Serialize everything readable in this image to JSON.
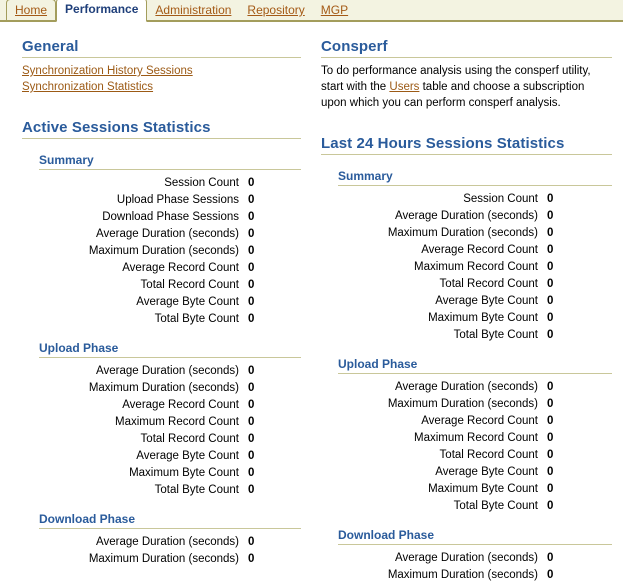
{
  "tabs": [
    {
      "label": "Home",
      "active": false,
      "style": "first"
    },
    {
      "label": "Performance",
      "active": true,
      "style": "active"
    },
    {
      "label": "Administration",
      "active": false,
      "style": "plain"
    },
    {
      "label": "Repository",
      "active": false,
      "style": "plain"
    },
    {
      "label": "MGP",
      "active": false,
      "style": "plain"
    }
  ],
  "general": {
    "heading": "General",
    "links": [
      "Synchronization History Sessions",
      "Synchronization Statistics"
    ]
  },
  "consperf": {
    "heading": "Consperf",
    "text_before": "To do performance analysis using the consperf utility, start with the ",
    "link": "Users",
    "text_after": " table and choose a subscription upon which you can perform consperf analysis."
  },
  "active_sessions": {
    "heading": "Active Sessions Statistics",
    "groups": [
      {
        "title": "Summary",
        "rows": [
          {
            "label": "Session Count",
            "value": "0"
          },
          {
            "label": "Upload Phase Sessions",
            "value": "0"
          },
          {
            "label": "Download Phase Sessions",
            "value": "0"
          },
          {
            "label": "Average Duration (seconds)",
            "value": "0"
          },
          {
            "label": "Maximum Duration (seconds)",
            "value": "0"
          },
          {
            "label": "Average Record Count",
            "value": "0"
          },
          {
            "label": "Total Record Count",
            "value": "0"
          },
          {
            "label": "Average Byte Count",
            "value": "0"
          },
          {
            "label": "Total Byte Count",
            "value": "0"
          }
        ]
      },
      {
        "title": "Upload Phase",
        "rows": [
          {
            "label": "Average Duration (seconds)",
            "value": "0"
          },
          {
            "label": "Maximum Duration (seconds)",
            "value": "0"
          },
          {
            "label": "Average Record Count",
            "value": "0"
          },
          {
            "label": "Maximum Record Count",
            "value": "0"
          },
          {
            "label": "Total Record Count",
            "value": "0"
          },
          {
            "label": "Average Byte Count",
            "value": "0"
          },
          {
            "label": "Maximum Byte Count",
            "value": "0"
          },
          {
            "label": "Total Byte Count",
            "value": "0"
          }
        ]
      },
      {
        "title": "Download Phase",
        "rows": [
          {
            "label": "Average Duration (seconds)",
            "value": "0"
          },
          {
            "label": "Maximum Duration (seconds)",
            "value": "0"
          }
        ]
      }
    ]
  },
  "last_24_hours": {
    "heading": "Last 24 Hours Sessions Statistics",
    "groups": [
      {
        "title": "Summary",
        "rows": [
          {
            "label": "Session Count",
            "value": "0"
          },
          {
            "label": "Average Duration (seconds)",
            "value": "0"
          },
          {
            "label": "Maximum Duration (seconds)",
            "value": "0"
          },
          {
            "label": "Average Record Count",
            "value": "0"
          },
          {
            "label": "Maximum Record Count",
            "value": "0"
          },
          {
            "label": "Total Record Count",
            "value": "0"
          },
          {
            "label": "Average Byte Count",
            "value": "0"
          },
          {
            "label": "Maximum Byte Count",
            "value": "0"
          },
          {
            "label": "Total Byte Count",
            "value": "0"
          }
        ]
      },
      {
        "title": "Upload Phase",
        "rows": [
          {
            "label": "Average Duration (seconds)",
            "value": "0"
          },
          {
            "label": "Maximum Duration (seconds)",
            "value": "0"
          },
          {
            "label": "Average Record Count",
            "value": "0"
          },
          {
            "label": "Maximum Record Count",
            "value": "0"
          },
          {
            "label": "Total Record Count",
            "value": "0"
          },
          {
            "label": "Average Byte Count",
            "value": "0"
          },
          {
            "label": "Maximum Byte Count",
            "value": "0"
          },
          {
            "label": "Total Byte Count",
            "value": "0"
          }
        ]
      },
      {
        "title": "Download Phase",
        "rows": [
          {
            "label": "Average Duration (seconds)",
            "value": "0"
          },
          {
            "label": "Maximum Duration (seconds)",
            "value": "0"
          }
        ]
      }
    ]
  },
  "colors": {
    "heading_blue": "#2a5b9b",
    "link_brown": "#9c5a15",
    "rule_olive": "#c9c79a",
    "tabbar_bg": "#f3f3e1",
    "tabbar_border": "#a39d5c"
  }
}
